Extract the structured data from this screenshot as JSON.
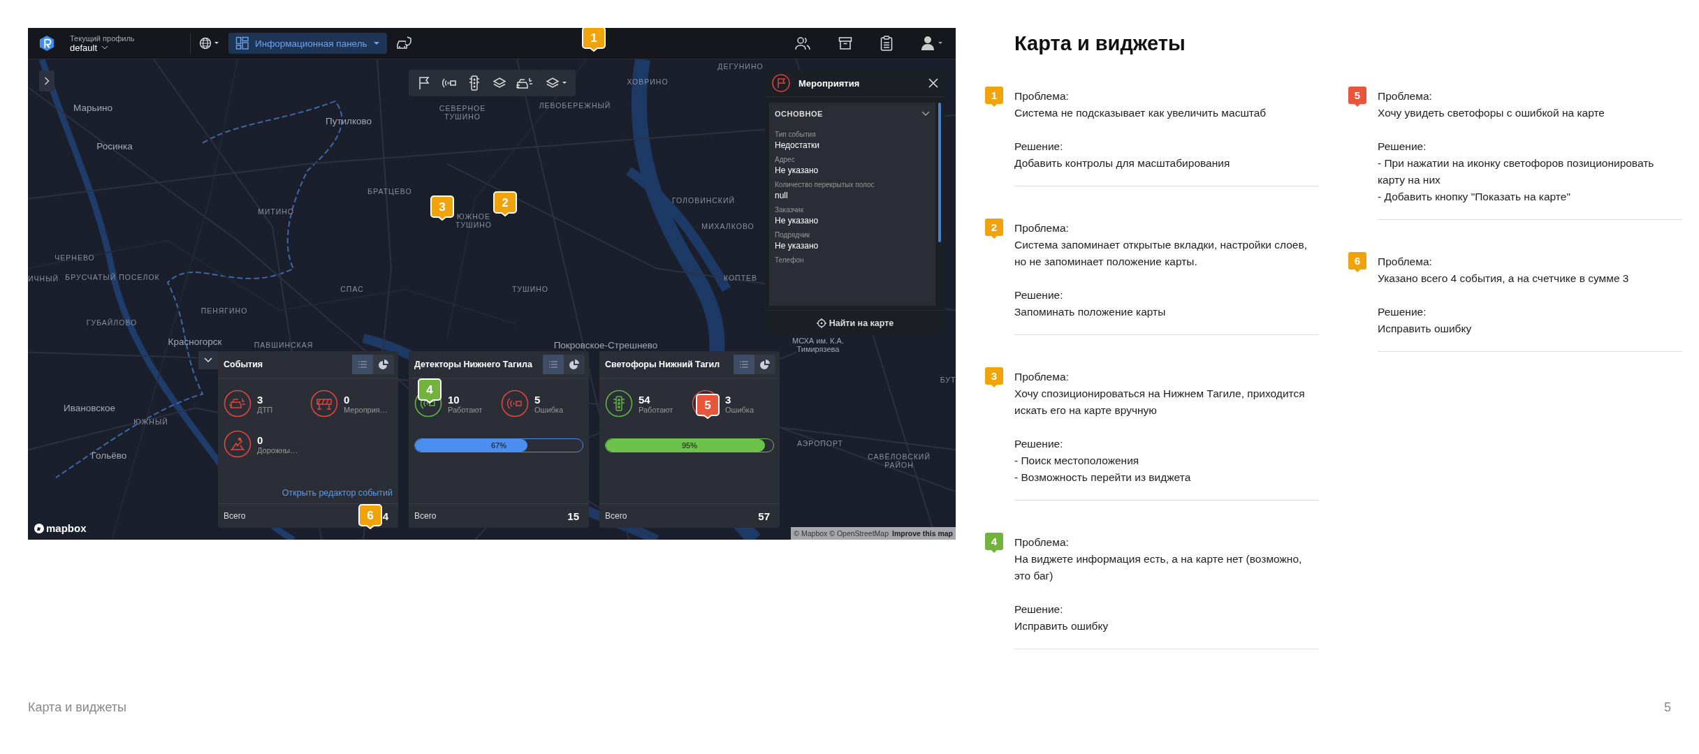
{
  "app": {
    "profile_label": "Текущий профиль",
    "profile_value": "default",
    "dashboard_button": "Информационная панель"
  },
  "map_labels": [
    "Марьино",
    "Росинка",
    "Путилково",
    "СЕВЕРНОЕ ТУШИНО",
    "ХОВРИНО",
    "ДЕГУНИНО",
    "ЛЕВОБЕРЕЖНЫЙ",
    "БРАТЦЕВО",
    "МИТИНО",
    "ЮЖНОЕ ТУШИНО",
    "ГОЛОВИНСКИЙ",
    "МИХАЛКОВО",
    "КОПТЕВ",
    "ТУШИНО",
    "ЧЕРНЕВО",
    "ИЧНЫЙ",
    "БРУСЧАТЫЙ ПОСЕЛОК",
    "СПАС",
    "ГУБАЙЛОВО",
    "ПЕНЯГИНО",
    "Красногорск",
    "ПАВШИНСКАЯ",
    "Ивановское",
    "ЮЖНЫЙ",
    "Гольёво",
    "Покровское-Стрешнево",
    "МСХА им. К.А. Тимирязева",
    "АЭРОПОРТ",
    "САВЁЛОВСКИЙ РАЙОН",
    "БУТ"
  ],
  "events_panel": {
    "title": "Мероприятия",
    "section": "ОСНОВНОЕ",
    "expanded": true,
    "fields": [
      {
        "label": "Тип события",
        "value": "Недостатки"
      },
      {
        "label": "Адрес",
        "value": "Не указано"
      },
      {
        "label": "Количество перекрытых полос",
        "value": "null"
      },
      {
        "label": "Заказчик",
        "value": "Не указано"
      },
      {
        "label": "Подрядчик",
        "value": "Не указано"
      },
      {
        "label": "Телефон"
      }
    ],
    "action": "Найти на карте"
  },
  "widgets": [
    {
      "title": "События",
      "view_modes": [
        {
          "kind": "list",
          "selected": true
        },
        {
          "kind": "pie",
          "selected": false
        }
      ],
      "stats": [
        {
          "kind": "crash",
          "error": true,
          "value": "3",
          "label": "ДТП"
        },
        {
          "kind": "barrier",
          "error": true,
          "value": "0",
          "label": "Мероприя…"
        },
        {
          "kind": "roadwork",
          "error": true,
          "value": "0",
          "label": "Дорожны…"
        }
      ],
      "link": "Открыть редактор событий",
      "total_label": "Всего",
      "total": "4"
    },
    {
      "title": "Детекторы Нижнего Тагила",
      "view_modes": [
        {
          "kind": "list",
          "selected": true
        },
        {
          "kind": "pie",
          "selected": false
        }
      ],
      "stats": [
        {
          "kind": "detector",
          "error": false,
          "value": "10",
          "label": "Работают"
        },
        {
          "kind": "detector",
          "error": true,
          "value": "5",
          "label": "Ошибка"
        }
      ],
      "progress": {
        "level": 0.67,
        "label": "67%",
        "color": "#4a8ff0"
      },
      "total_label": "Всего",
      "total": "15"
    },
    {
      "title": "Светофоры Нижний Тагил",
      "view_modes": [
        {
          "kind": "list",
          "selected": true
        },
        {
          "kind": "pie",
          "selected": false
        }
      ],
      "stats": [
        {
          "kind": "traffic-light",
          "error": false,
          "value": "54",
          "label": "Работают"
        },
        {
          "kind": "traffic-light",
          "error": true,
          "value": "3",
          "label": "Ошибка"
        }
      ],
      "progress": {
        "level": 0.95,
        "label": "95%",
        "color": "#6cc24a"
      },
      "total_label": "Всего",
      "total": "57"
    }
  ],
  "map_attribution": {
    "logo": "mapbox",
    "text": "© Mapbox © OpenStreetMap",
    "link": "Improve this map"
  },
  "callouts": [
    {
      "number": "1",
      "color": "#f0a30a"
    },
    {
      "number": "2",
      "color": "#f0a30a"
    },
    {
      "number": "3",
      "color": "#f0a30a"
    },
    {
      "number": "4",
      "color": "#72b33e"
    },
    {
      "number": "5",
      "color": "#e8553a"
    },
    {
      "number": "6",
      "color": "#f0a30a"
    }
  ],
  "page": {
    "title": "Карта и виджеты"
  },
  "notes_columns": [
    [
      {
        "number": "1",
        "color": "#f0a30a",
        "problem_label": "Проблема:",
        "problem": "Система не подсказывает как увеличить масштаб",
        "solution_label": "Решение:",
        "solution": [
          "Добавить контролы для масштабирования"
        ]
      },
      {
        "number": "2",
        "color": "#f0a30a",
        "problem_label": "Проблема:",
        "problem": "Система запоминает открытые вкладки, настройки слоев, но не запоминает положение карты.",
        "solution_label": "Решение:",
        "solution": [
          "Запоминать положение карты"
        ]
      },
      {
        "number": "3",
        "color": "#f0a30a",
        "problem_label": "Проблема:",
        "problem": "Хочу спозиционироваться на Нижнем Тагиле, приходится искать его на карте вручную",
        "solution_label": "Решение:",
        "solution": [
          "- Поиск местоположения",
          "- Возможность перейти из виджета"
        ]
      },
      {
        "number": "4",
        "color": "#72b33e",
        "problem_label": "Проблема:",
        "problem": "На виджете информация есть, а на карте нет (возможно, это баг)",
        "solution_label": "Решение:",
        "solution": [
          "Исправить ошибку"
        ]
      }
    ],
    [
      {
        "number": "5",
        "color": "#e8553a",
        "problem_label": "Проблема:",
        "problem": "Хочу увидеть светофоры с ошибкой на карте",
        "solution_label": "Решение:",
        "solution": [
          "- При нажатии на иконку светофоров позиционировать карту на них",
          "- Добавить кнопку \"Показать на карте\""
        ]
      },
      {
        "number": "6",
        "color": "#f0a30a",
        "problem_label": "Проблема:",
        "problem": "Указано всего 4 события, а на счетчике в сумме 3",
        "solution_label": "Решение:",
        "solution": [
          "Исправить ошибку"
        ]
      }
    ]
  ],
  "footer": {
    "title": "Карта и виджеты",
    "page_number": "5"
  }
}
